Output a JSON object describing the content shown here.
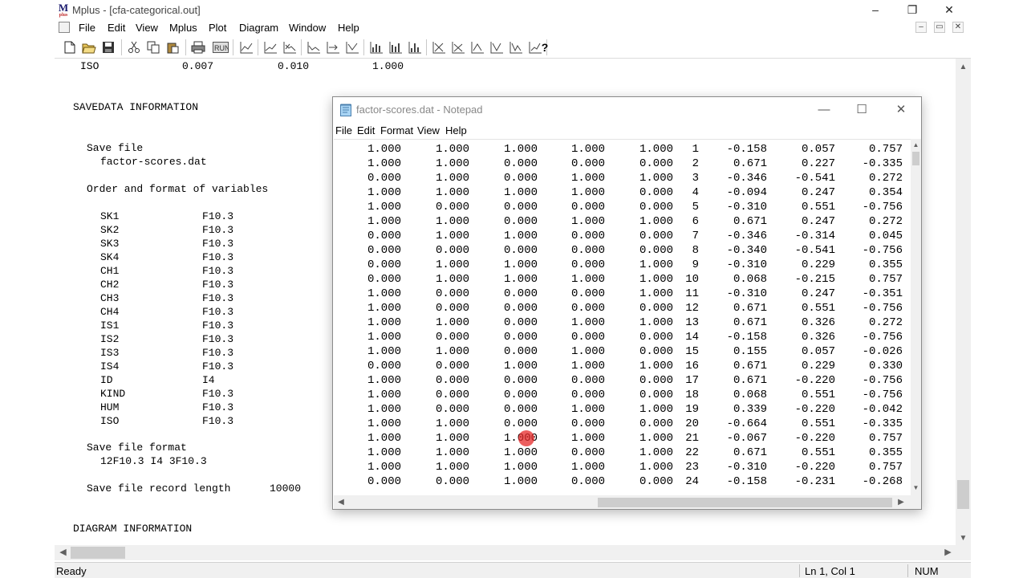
{
  "app": {
    "title": "Mplus - [cfa-categorical.out]",
    "logo_text": "M",
    "logo_sub": "plus",
    "window_controls": {
      "minimize": "–",
      "maximize": "❐",
      "close": "✕"
    },
    "mdi_controls": {
      "minimize": "–",
      "restore": "▭",
      "close": "✕"
    }
  },
  "menubar": {
    "items": [
      "File",
      "Edit",
      "View",
      "Mplus",
      "Plot",
      "Diagram",
      "Window",
      "Help"
    ]
  },
  "toolbar": {
    "icons": [
      "new-icon",
      "open-icon",
      "save-icon",
      "cut-icon",
      "copy-icon",
      "paste-icon",
      "print-icon",
      "run-icon",
      "plot-1-icon",
      "plot-2-icon",
      "plot-3-icon",
      "plot-4-icon",
      "plot-5-icon",
      "plot-6-icon",
      "plot-7-icon",
      "plot-8-icon",
      "plot-9-icon",
      "plot-10-icon",
      "plot-11-icon",
      "plot-12-icon",
      "plot-13-icon",
      "plot-14-icon",
      "plot-15-icon",
      "help-icon"
    ],
    "help_label": "?"
  },
  "output": {
    "top_row": {
      "name": "ISO",
      "v1": "0.007",
      "v2": "0.010",
      "v3": "1.000"
    },
    "savedata_heading": "SAVEDATA INFORMATION",
    "save_file_label": "Save file",
    "save_file_name": "factor-scores.dat",
    "order_label": "Order and format of variables",
    "variables": [
      {
        "name": "SK1",
        "format": "F10.3"
      },
      {
        "name": "SK2",
        "format": "F10.3"
      },
      {
        "name": "SK3",
        "format": "F10.3"
      },
      {
        "name": "SK4",
        "format": "F10.3"
      },
      {
        "name": "CH1",
        "format": "F10.3"
      },
      {
        "name": "CH2",
        "format": "F10.3"
      },
      {
        "name": "CH3",
        "format": "F10.3"
      },
      {
        "name": "CH4",
        "format": "F10.3"
      },
      {
        "name": "IS1",
        "format": "F10.3"
      },
      {
        "name": "IS2",
        "format": "F10.3"
      },
      {
        "name": "IS3",
        "format": "F10.3"
      },
      {
        "name": "IS4",
        "format": "F10.3"
      },
      {
        "name": "ID",
        "format": "I4"
      },
      {
        "name": "KIND",
        "format": "F10.3"
      },
      {
        "name": "HUM",
        "format": "F10.3"
      },
      {
        "name": "ISO",
        "format": "F10.3"
      }
    ],
    "save_format_label": "Save file format",
    "save_format_value": "12F10.3 I4 3F10.3",
    "record_length_label": "Save file record length",
    "record_length_value": "10000",
    "diagram_heading": "DIAGRAM INFORMATION"
  },
  "statusbar": {
    "ready": "Ready",
    "position": "Ln 1, Col 1",
    "num": "NUM"
  },
  "notepad": {
    "title": "factor-scores.dat - Notepad",
    "window_controls": {
      "minimize": "—",
      "maximize": "☐",
      "close": "✕"
    },
    "menu": [
      "File",
      "Edit",
      "Format",
      "View",
      "Help"
    ],
    "rows": [
      [
        "1.000",
        "1.000",
        "1.000",
        "1.000",
        "1.000",
        "1",
        "-0.158",
        "0.057",
        "0.757"
      ],
      [
        "1.000",
        "1.000",
        "0.000",
        "0.000",
        "0.000",
        "2",
        "0.671",
        "0.227",
        "-0.335"
      ],
      [
        "0.000",
        "1.000",
        "0.000",
        "1.000",
        "1.000",
        "3",
        "-0.346",
        "-0.541",
        "0.272"
      ],
      [
        "1.000",
        "1.000",
        "1.000",
        "1.000",
        "0.000",
        "4",
        "-0.094",
        "0.247",
        "0.354"
      ],
      [
        "1.000",
        "0.000",
        "0.000",
        "0.000",
        "0.000",
        "5",
        "-0.310",
        "0.551",
        "-0.756"
      ],
      [
        "1.000",
        "1.000",
        "0.000",
        "1.000",
        "1.000",
        "6",
        "0.671",
        "0.247",
        "0.272"
      ],
      [
        "0.000",
        "1.000",
        "1.000",
        "0.000",
        "0.000",
        "7",
        "-0.346",
        "-0.314",
        "0.045"
      ],
      [
        "0.000",
        "0.000",
        "0.000",
        "0.000",
        "0.000",
        "8",
        "-0.340",
        "-0.541",
        "-0.756"
      ],
      [
        "0.000",
        "1.000",
        "1.000",
        "0.000",
        "1.000",
        "9",
        "-0.310",
        "0.229",
        "0.355"
      ],
      [
        "0.000",
        "1.000",
        "1.000",
        "1.000",
        "1.000",
        "10",
        "0.068",
        "-0.215",
        "0.757"
      ],
      [
        "1.000",
        "0.000",
        "0.000",
        "0.000",
        "1.000",
        "11",
        "-0.310",
        "0.247",
        "-0.351"
      ],
      [
        "1.000",
        "0.000",
        "0.000",
        "0.000",
        "0.000",
        "12",
        "0.671",
        "0.551",
        "-0.756"
      ],
      [
        "1.000",
        "1.000",
        "0.000",
        "1.000",
        "1.000",
        "13",
        "0.671",
        "0.326",
        "0.272"
      ],
      [
        "1.000",
        "0.000",
        "0.000",
        "0.000",
        "0.000",
        "14",
        "-0.158",
        "0.326",
        "-0.756"
      ],
      [
        "1.000",
        "1.000",
        "0.000",
        "1.000",
        "0.000",
        "15",
        "0.155",
        "0.057",
        "-0.026"
      ],
      [
        "0.000",
        "0.000",
        "1.000",
        "1.000",
        "1.000",
        "16",
        "0.671",
        "0.229",
        "0.330"
      ],
      [
        "1.000",
        "0.000",
        "0.000",
        "0.000",
        "0.000",
        "17",
        "0.671",
        "-0.220",
        "-0.756"
      ],
      [
        "1.000",
        "0.000",
        "0.000",
        "0.000",
        "0.000",
        "18",
        "0.068",
        "0.551",
        "-0.756"
      ],
      [
        "1.000",
        "0.000",
        "0.000",
        "1.000",
        "1.000",
        "19",
        "0.339",
        "-0.220",
        "-0.042"
      ],
      [
        "1.000",
        "1.000",
        "0.000",
        "0.000",
        "0.000",
        "20",
        "-0.664",
        "0.551",
        "-0.335"
      ],
      [
        "1.000",
        "1.000",
        "1.000",
        "1.000",
        "1.000",
        "21",
        "-0.067",
        "-0.220",
        "0.757"
      ],
      [
        "1.000",
        "1.000",
        "1.000",
        "0.000",
        "1.000",
        "22",
        "0.671",
        "0.551",
        "0.355"
      ],
      [
        "1.000",
        "1.000",
        "1.000",
        "1.000",
        "1.000",
        "23",
        "-0.310",
        "-0.220",
        "0.757"
      ],
      [
        "0.000",
        "0.000",
        "1.000",
        "0.000",
        "0.000",
        "24",
        "-0.158",
        "-0.231",
        "-0.268"
      ]
    ]
  }
}
